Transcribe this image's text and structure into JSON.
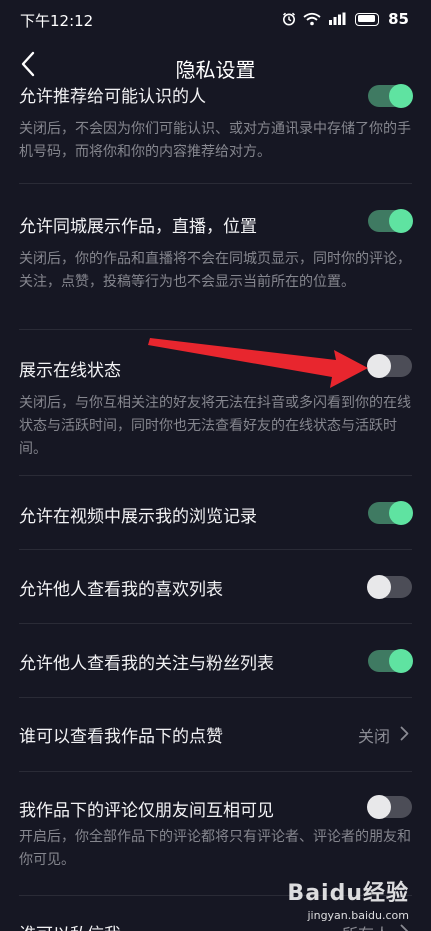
{
  "status_bar": {
    "time": "下午12:12",
    "battery": "85",
    "icons": [
      "alarm-icon",
      "wifi-icon",
      "signal-icon",
      "battery-icon"
    ]
  },
  "nav": {
    "title": "隐私设置",
    "back_icon": "chevron-left-icon"
  },
  "colors": {
    "background": "#161723",
    "toggle_on_track": "#3f7a62",
    "toggle_on_knob": "#5fe3a1",
    "toggle_off_track": "#4c4d57",
    "toggle_off_knob": "#e8e8ea",
    "annotation_arrow": "#e8262e"
  },
  "settings": [
    {
      "title": "允许推荐给可能认识的人",
      "description": "关闭后，不会因为你们可能认识、或对方通讯录中存储了你的手机号码，而将你和你的内容推荐给对方。",
      "toggle": "on"
    },
    {
      "title": "允许同城展示作品，直播，位置",
      "description": "关闭后，你的作品和直播将不会在同城页显示，同时你的评论，关注，点赞，投稿等行为也不会显示当前所在的位置。",
      "toggle": "on"
    },
    {
      "title": "展示在线状态",
      "description": "关闭后，与你互相关注的好友将无法在抖音或多闪看到你的在线状态与活跃时间，同时你也无法查看好友的在线状态与活跃时间。",
      "toggle": "off"
    },
    {
      "title": "允许在视频中展示我的浏览记录",
      "toggle": "on"
    },
    {
      "title": "允许他人查看我的喜欢列表",
      "toggle": "off"
    },
    {
      "title": "允许他人查看我的关注与粉丝列表",
      "toggle": "on"
    },
    {
      "title": "谁可以查看我作品下的点赞",
      "value": "关闭"
    },
    {
      "title": "我作品下的评论仅朋友间互相可见",
      "description": "开启后，你全部作品下的评论都将只有评论者、评论者的朋友和你可见。",
      "toggle": "off"
    },
    {
      "title": "谁可以私信我",
      "value": "所有人"
    }
  ],
  "watermark": {
    "logo": "Baidu经验",
    "url": "jingyan.baidu.com"
  }
}
